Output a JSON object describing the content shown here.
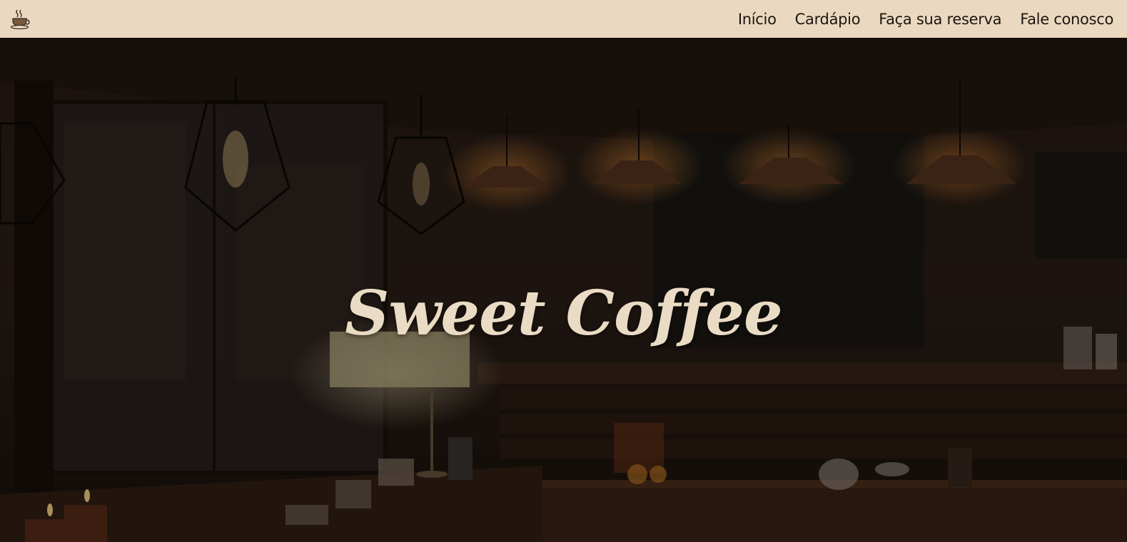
{
  "header": {
    "logo_icon": "coffee-cup-icon",
    "background_color": "#ead9c0",
    "nav": [
      {
        "label": "Início"
      },
      {
        "label": "Cardápio"
      },
      {
        "label": "Faça sua reserva"
      },
      {
        "label": "Fale conosco"
      }
    ]
  },
  "hero": {
    "title": "Sweet Coffee",
    "title_color": "#eadbc4",
    "background_description_icon": "cafe-interior-image"
  }
}
